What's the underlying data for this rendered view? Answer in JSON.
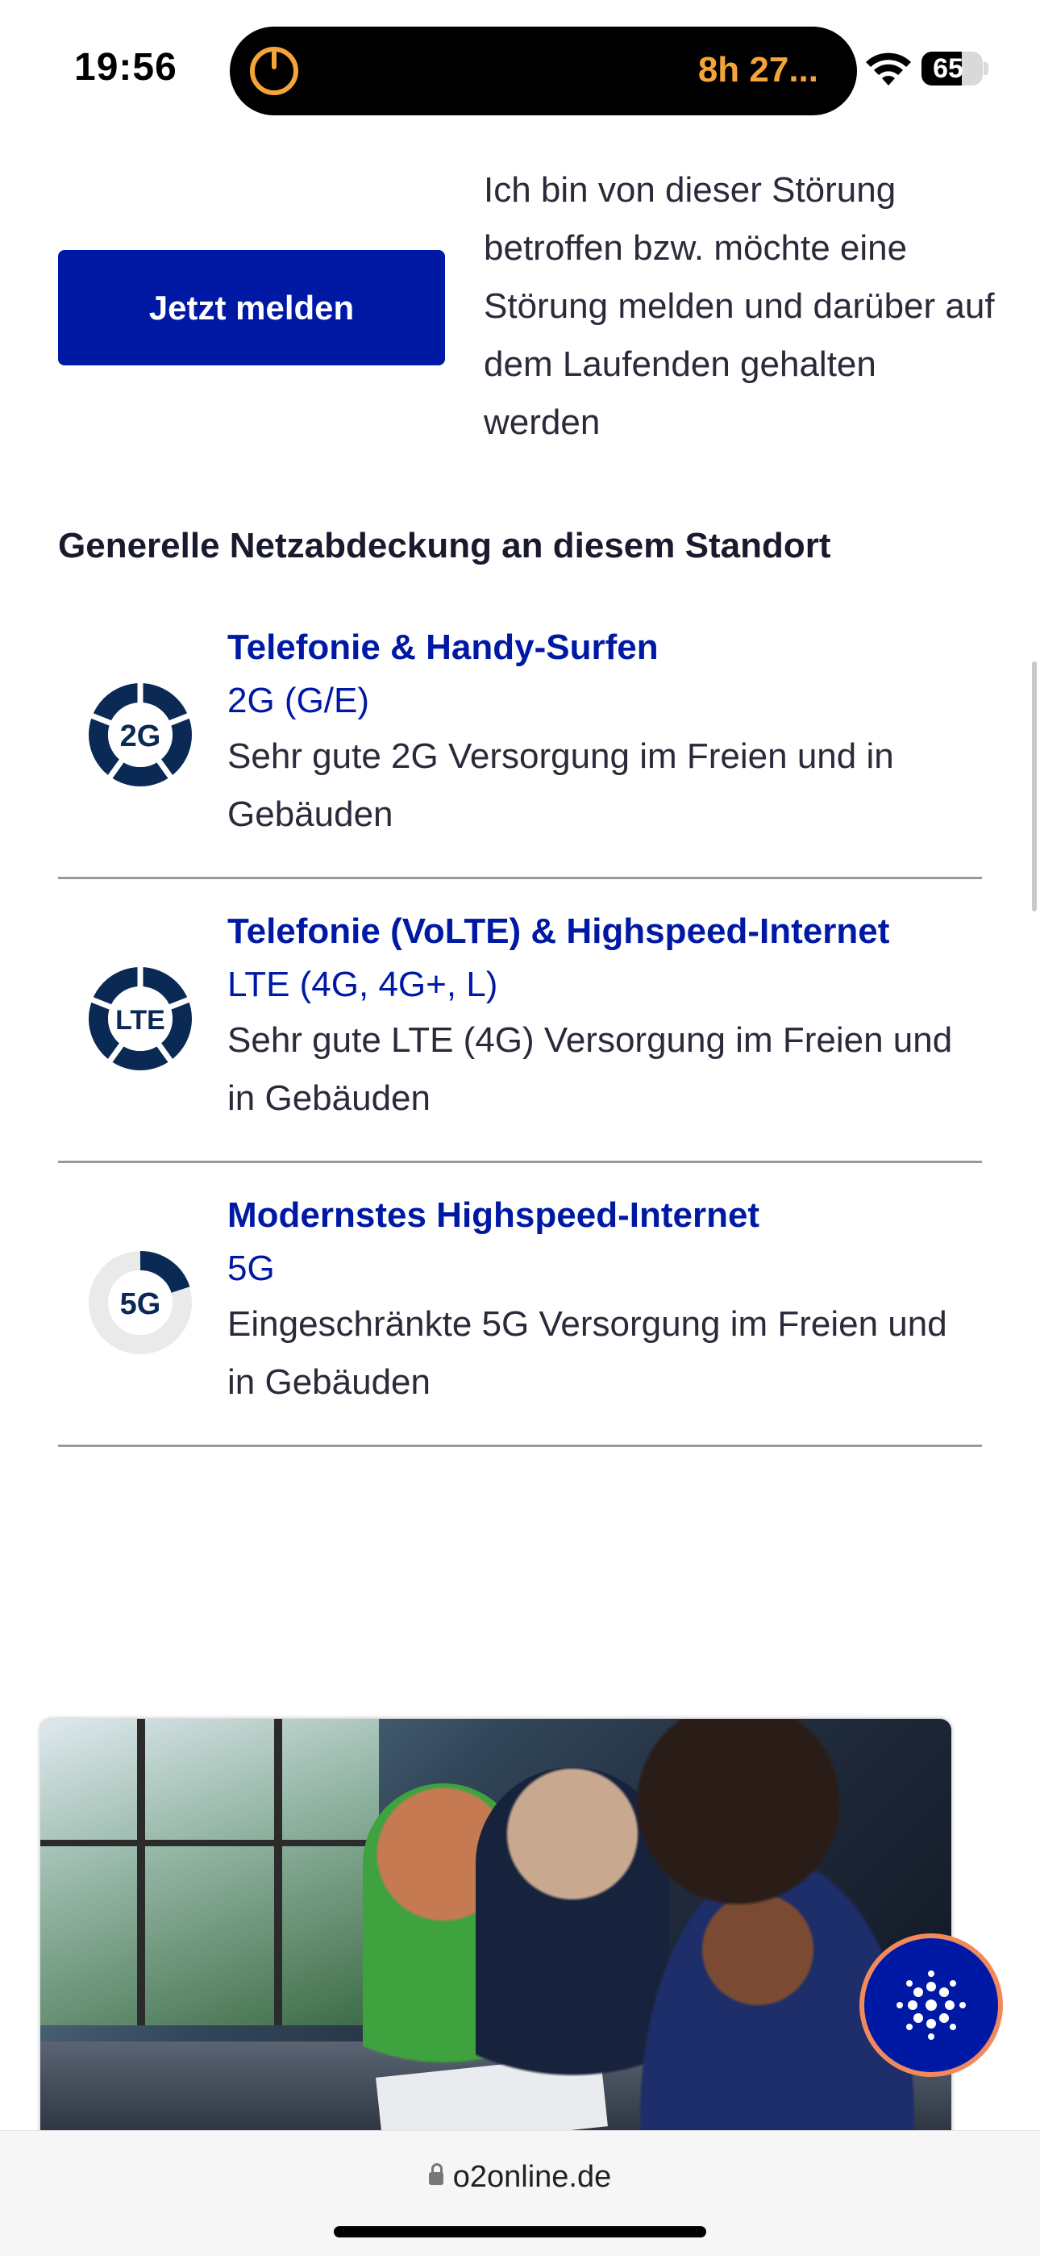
{
  "status_bar": {
    "time": "19:56",
    "live_activity": "8h 27...",
    "battery": "65",
    "accent": "#f5a43a"
  },
  "report": {
    "button_label": "Jetzt melden",
    "description": "Ich bin von dieser Störung betroffen bzw. möchte eine Störung melden und darüber auf dem Laufenden gehalten werden"
  },
  "coverage": {
    "heading": "Generelle Netzabdeckung an diesem Standort",
    "items": [
      {
        "icon_label": "2G",
        "title": "Telefonie & Handy-Surfen",
        "technology": "2G (G/E)",
        "description": "Sehr gute 2G Versorgung im Freien und in Gebäuden",
        "rating": "full"
      },
      {
        "icon_label": "LTE",
        "title": "Telefonie (VoLTE) & Highspeed-Internet",
        "technology": "LTE (4G, 4G+, L)",
        "description": "Sehr gute LTE (4G) Versorgung im Freien und in Gebäuden",
        "rating": "full"
      },
      {
        "icon_label": "5G",
        "title": "Modernstes Highspeed-Internet",
        "technology": "5G",
        "description": "Eingeschränkte 5G Versorgung im Freien und in Gebäuden",
        "rating": "partial"
      }
    ]
  },
  "browser": {
    "url": "o2online.de"
  },
  "colors": {
    "brand_blue": "#0019a5",
    "chat_ring": "#f08a5d"
  }
}
